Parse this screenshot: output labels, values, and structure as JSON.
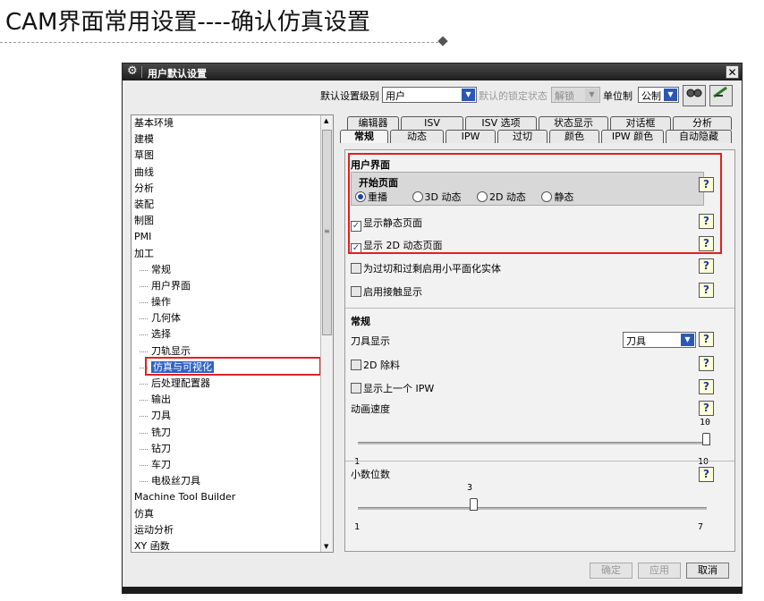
{
  "slide": {
    "title": "CAM界面常用设置----确认仿真设置"
  },
  "dialog": {
    "title": "用户默认设置"
  },
  "toolbar": {
    "level_label": "默认设置级别",
    "level_value": "用户",
    "lock_label": "默认的锁定状态",
    "lock_value": "解锁",
    "unit_label": "单位制",
    "unit_value": "公制"
  },
  "tree": {
    "items": [
      {
        "label": "基本环境",
        "child": false
      },
      {
        "label": "建模",
        "child": false
      },
      {
        "label": "草图",
        "child": false
      },
      {
        "label": "曲线",
        "child": false
      },
      {
        "label": "分析",
        "child": false
      },
      {
        "label": "装配",
        "child": false
      },
      {
        "label": "制图",
        "child": false
      },
      {
        "label": "PMI",
        "child": false
      },
      {
        "label": "加工",
        "child": false
      },
      {
        "label": "常规",
        "child": true
      },
      {
        "label": "用户界面",
        "child": true
      },
      {
        "label": "操作",
        "child": true
      },
      {
        "label": "几何体",
        "child": true
      },
      {
        "label": "选择",
        "child": true
      },
      {
        "label": "刀轨显示",
        "child": true
      },
      {
        "label": "仿真与可视化",
        "child": true,
        "selected": true
      },
      {
        "label": "后处理配置器",
        "child": true
      },
      {
        "label": "输出",
        "child": true
      },
      {
        "label": "刀具",
        "child": true
      },
      {
        "label": "铣刀",
        "child": true
      },
      {
        "label": "钻刀",
        "child": true
      },
      {
        "label": "车刀",
        "child": true
      },
      {
        "label": "电极丝刀具",
        "child": true
      },
      {
        "label": "Machine Tool Builder",
        "child": false
      },
      {
        "label": "仿真",
        "child": false
      },
      {
        "label": "运动分析",
        "child": false
      },
      {
        "label": "XY 函数",
        "child": false
      }
    ]
  },
  "tabs": {
    "row1": [
      "编辑器",
      "ISV",
      "ISV 选项",
      "状态显示",
      "对话框",
      "分析"
    ],
    "row2": [
      "常规",
      "动态",
      "IPW",
      "过切",
      "颜色",
      "IPW 颜色",
      "自动隐藏"
    ]
  },
  "ui_section": {
    "heading": "用户界面",
    "start_page": "开始页面",
    "radios": [
      "重播",
      "3D 动态",
      "2D 动态",
      "静态"
    ],
    "show_static": "显示静态页面",
    "show_2d": "显示 2D 动态页面",
    "enable_small_plane": "为过切和过剩启用小平面化实体",
    "enable_contact": "启用接触显示"
  },
  "general_section": {
    "heading": "常规",
    "tool_display_label": "刀具显示",
    "tool_display_value": "刀具",
    "residual_2d": "2D 除料",
    "show_prev_ipw": "显示上一个 IPW",
    "anim_speed_label": "动画速度",
    "anim_speed": {
      "value": 10,
      "min": 1,
      "max": 10
    },
    "decimals_label": "小数位数",
    "decimals": {
      "value": 3,
      "min": 1,
      "max": 7
    }
  },
  "help_glyph": "?",
  "buttons": {
    "ok": "确定",
    "apply": "应用",
    "cancel": "取消"
  },
  "icons": {
    "gear": "⚙",
    "close": "✕",
    "arrow": "▼",
    "up": "▲",
    "check": "✓",
    "grip": "≡"
  }
}
